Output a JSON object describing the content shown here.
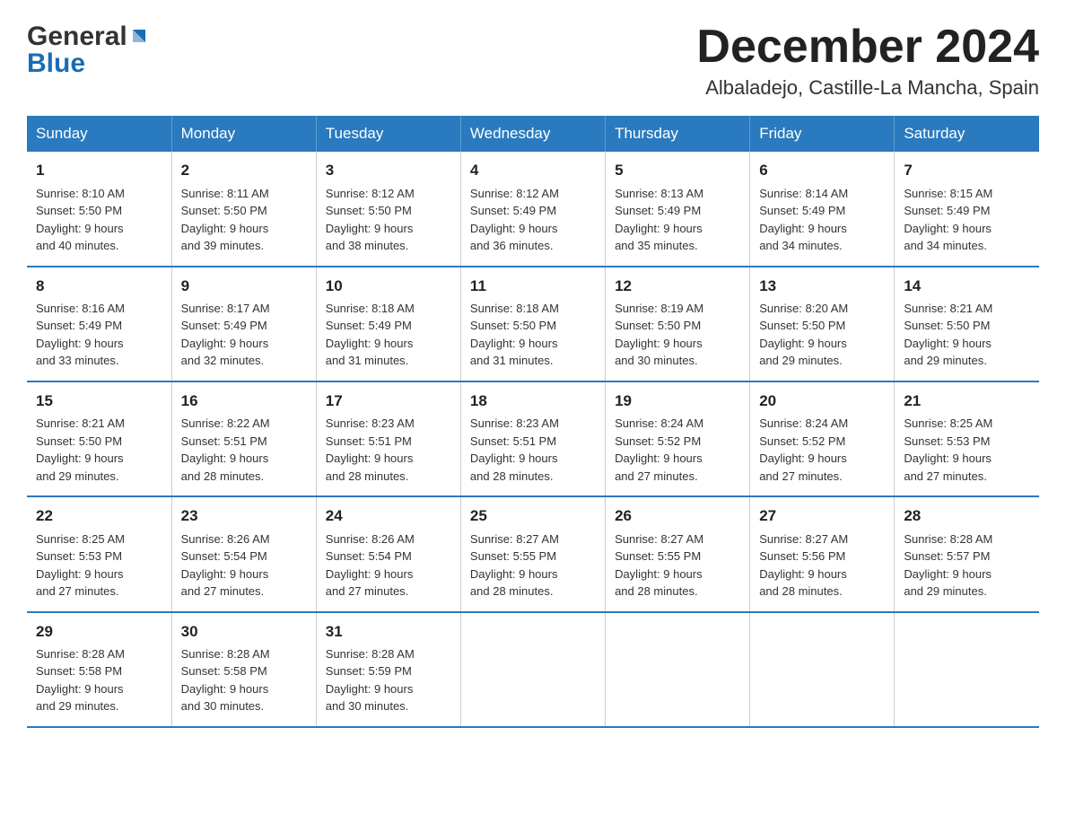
{
  "header": {
    "title": "December 2024",
    "location": "Albaladejo, Castille-La Mancha, Spain",
    "logo_general": "General",
    "logo_blue": "Blue"
  },
  "days_of_week": [
    "Sunday",
    "Monday",
    "Tuesday",
    "Wednesday",
    "Thursday",
    "Friday",
    "Saturday"
  ],
  "weeks": [
    [
      {
        "day": "1",
        "sunrise": "8:10 AM",
        "sunset": "5:50 PM",
        "daylight": "9 hours and 40 minutes."
      },
      {
        "day": "2",
        "sunrise": "8:11 AM",
        "sunset": "5:50 PM",
        "daylight": "9 hours and 39 minutes."
      },
      {
        "day": "3",
        "sunrise": "8:12 AM",
        "sunset": "5:50 PM",
        "daylight": "9 hours and 38 minutes."
      },
      {
        "day": "4",
        "sunrise": "8:12 AM",
        "sunset": "5:49 PM",
        "daylight": "9 hours and 36 minutes."
      },
      {
        "day": "5",
        "sunrise": "8:13 AM",
        "sunset": "5:49 PM",
        "daylight": "9 hours and 35 minutes."
      },
      {
        "day": "6",
        "sunrise": "8:14 AM",
        "sunset": "5:49 PM",
        "daylight": "9 hours and 34 minutes."
      },
      {
        "day": "7",
        "sunrise": "8:15 AM",
        "sunset": "5:49 PM",
        "daylight": "9 hours and 34 minutes."
      }
    ],
    [
      {
        "day": "8",
        "sunrise": "8:16 AM",
        "sunset": "5:49 PM",
        "daylight": "9 hours and 33 minutes."
      },
      {
        "day": "9",
        "sunrise": "8:17 AM",
        "sunset": "5:49 PM",
        "daylight": "9 hours and 32 minutes."
      },
      {
        "day": "10",
        "sunrise": "8:18 AM",
        "sunset": "5:49 PM",
        "daylight": "9 hours and 31 minutes."
      },
      {
        "day": "11",
        "sunrise": "8:18 AM",
        "sunset": "5:50 PM",
        "daylight": "9 hours and 31 minutes."
      },
      {
        "day": "12",
        "sunrise": "8:19 AM",
        "sunset": "5:50 PM",
        "daylight": "9 hours and 30 minutes."
      },
      {
        "day": "13",
        "sunrise": "8:20 AM",
        "sunset": "5:50 PM",
        "daylight": "9 hours and 29 minutes."
      },
      {
        "day": "14",
        "sunrise": "8:21 AM",
        "sunset": "5:50 PM",
        "daylight": "9 hours and 29 minutes."
      }
    ],
    [
      {
        "day": "15",
        "sunrise": "8:21 AM",
        "sunset": "5:50 PM",
        "daylight": "9 hours and 29 minutes."
      },
      {
        "day": "16",
        "sunrise": "8:22 AM",
        "sunset": "5:51 PM",
        "daylight": "9 hours and 28 minutes."
      },
      {
        "day": "17",
        "sunrise": "8:23 AM",
        "sunset": "5:51 PM",
        "daylight": "9 hours and 28 minutes."
      },
      {
        "day": "18",
        "sunrise": "8:23 AM",
        "sunset": "5:51 PM",
        "daylight": "9 hours and 28 minutes."
      },
      {
        "day": "19",
        "sunrise": "8:24 AM",
        "sunset": "5:52 PM",
        "daylight": "9 hours and 27 minutes."
      },
      {
        "day": "20",
        "sunrise": "8:24 AM",
        "sunset": "5:52 PM",
        "daylight": "9 hours and 27 minutes."
      },
      {
        "day": "21",
        "sunrise": "8:25 AM",
        "sunset": "5:53 PM",
        "daylight": "9 hours and 27 minutes."
      }
    ],
    [
      {
        "day": "22",
        "sunrise": "8:25 AM",
        "sunset": "5:53 PM",
        "daylight": "9 hours and 27 minutes."
      },
      {
        "day": "23",
        "sunrise": "8:26 AM",
        "sunset": "5:54 PM",
        "daylight": "9 hours and 27 minutes."
      },
      {
        "day": "24",
        "sunrise": "8:26 AM",
        "sunset": "5:54 PM",
        "daylight": "9 hours and 27 minutes."
      },
      {
        "day": "25",
        "sunrise": "8:27 AM",
        "sunset": "5:55 PM",
        "daylight": "9 hours and 28 minutes."
      },
      {
        "day": "26",
        "sunrise": "8:27 AM",
        "sunset": "5:55 PM",
        "daylight": "9 hours and 28 minutes."
      },
      {
        "day": "27",
        "sunrise": "8:27 AM",
        "sunset": "5:56 PM",
        "daylight": "9 hours and 28 minutes."
      },
      {
        "day": "28",
        "sunrise": "8:28 AM",
        "sunset": "5:57 PM",
        "daylight": "9 hours and 29 minutes."
      }
    ],
    [
      {
        "day": "29",
        "sunrise": "8:28 AM",
        "sunset": "5:58 PM",
        "daylight": "9 hours and 29 minutes."
      },
      {
        "day": "30",
        "sunrise": "8:28 AM",
        "sunset": "5:58 PM",
        "daylight": "9 hours and 30 minutes."
      },
      {
        "day": "31",
        "sunrise": "8:28 AM",
        "sunset": "5:59 PM",
        "daylight": "9 hours and 30 minutes."
      },
      null,
      null,
      null,
      null
    ]
  ],
  "labels": {
    "sunrise_prefix": "Sunrise: ",
    "sunset_prefix": "Sunset: ",
    "daylight_prefix": "Daylight: "
  }
}
